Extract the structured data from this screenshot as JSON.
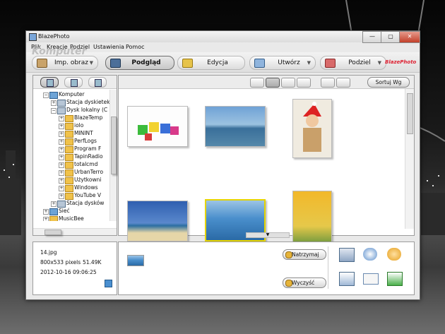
{
  "window": {
    "title": "BlazePhoto"
  },
  "window_controls": {
    "minimize": "—",
    "maximize": "▢",
    "close": "✕"
  },
  "menu": [
    "Plik",
    "Kreacje",
    "Podziel",
    "Ustawienia",
    "Pomoc"
  ],
  "watermark": "Komputer",
  "toolbar": {
    "import_label": "Imp. obraz",
    "preview_label": "Podgląd",
    "edit_label": "Edycja",
    "create_label": "Utwórz",
    "share_label": "Podziel",
    "brand_logo": "BlazePhoto"
  },
  "tree": [
    {
      "label": "Komputer",
      "icon": "computer-icon",
      "level": 0,
      "expand": "−"
    },
    {
      "label": "Stacja dyskietek",
      "icon": "drive-icon",
      "level": 1,
      "expand": "+"
    },
    {
      "label": "Dysk lokalny (C",
      "icon": "drive-icon",
      "level": 1,
      "expand": "−"
    },
    {
      "label": "BlazeTemp",
      "icon": "folder-icon",
      "level": 2,
      "expand": "+"
    },
    {
      "label": "iolo",
      "icon": "folder-icon",
      "level": 2,
      "expand": "+"
    },
    {
      "label": "MININT",
      "icon": "folder-icon",
      "level": 2,
      "expand": "+"
    },
    {
      "label": "PerfLogs",
      "icon": "folder-icon",
      "level": 2,
      "expand": "+"
    },
    {
      "label": "Program F",
      "icon": "folder-icon",
      "level": 2,
      "expand": "+"
    },
    {
      "label": "TapinRadio",
      "icon": "folder-icon",
      "level": 2,
      "expand": "+"
    },
    {
      "label": "totalcmd",
      "icon": "folder-icon",
      "level": 2,
      "expand": "+"
    },
    {
      "label": "UrbanTerro",
      "icon": "folder-icon",
      "level": 2,
      "expand": "+"
    },
    {
      "label": "Użytkowni",
      "icon": "folder-icon",
      "level": 2,
      "expand": "+"
    },
    {
      "label": "Windows",
      "icon": "folder-icon",
      "level": 2,
      "expand": "+"
    },
    {
      "label": "YouTube V",
      "icon": "folder-icon",
      "level": 2,
      "expand": "+"
    },
    {
      "label": "Stacja dysków",
      "icon": "drive-icon",
      "level": 1,
      "expand": "+"
    },
    {
      "label": "Sieć",
      "icon": "network-icon",
      "level": 0,
      "expand": "+"
    },
    {
      "label": "MusicBee",
      "icon": "folder-icon",
      "level": 0,
      "expand": "+"
    }
  ],
  "view": {
    "sort_label": "Sortuj Wg"
  },
  "thumbnails": [
    {
      "desc": "dice",
      "selected": false
    },
    {
      "desc": "sea",
      "selected": false
    },
    {
      "desc": "santa",
      "selected": false
    },
    {
      "desc": "beach",
      "selected": false
    },
    {
      "desc": "boats",
      "selected": true
    },
    {
      "desc": "balloons",
      "selected": false
    }
  ],
  "info": {
    "filename": "14.jpg",
    "dimensions": "800x533 pixels",
    "filesize": "51.49K",
    "datetime": "2012-10-16 09:06:25"
  },
  "tray": {
    "hold_label": "Natrzymaj",
    "clear_label": "Wyczyść"
  },
  "colors": {
    "accent": "#e6d400",
    "window_bg": "#e9e9e9"
  }
}
